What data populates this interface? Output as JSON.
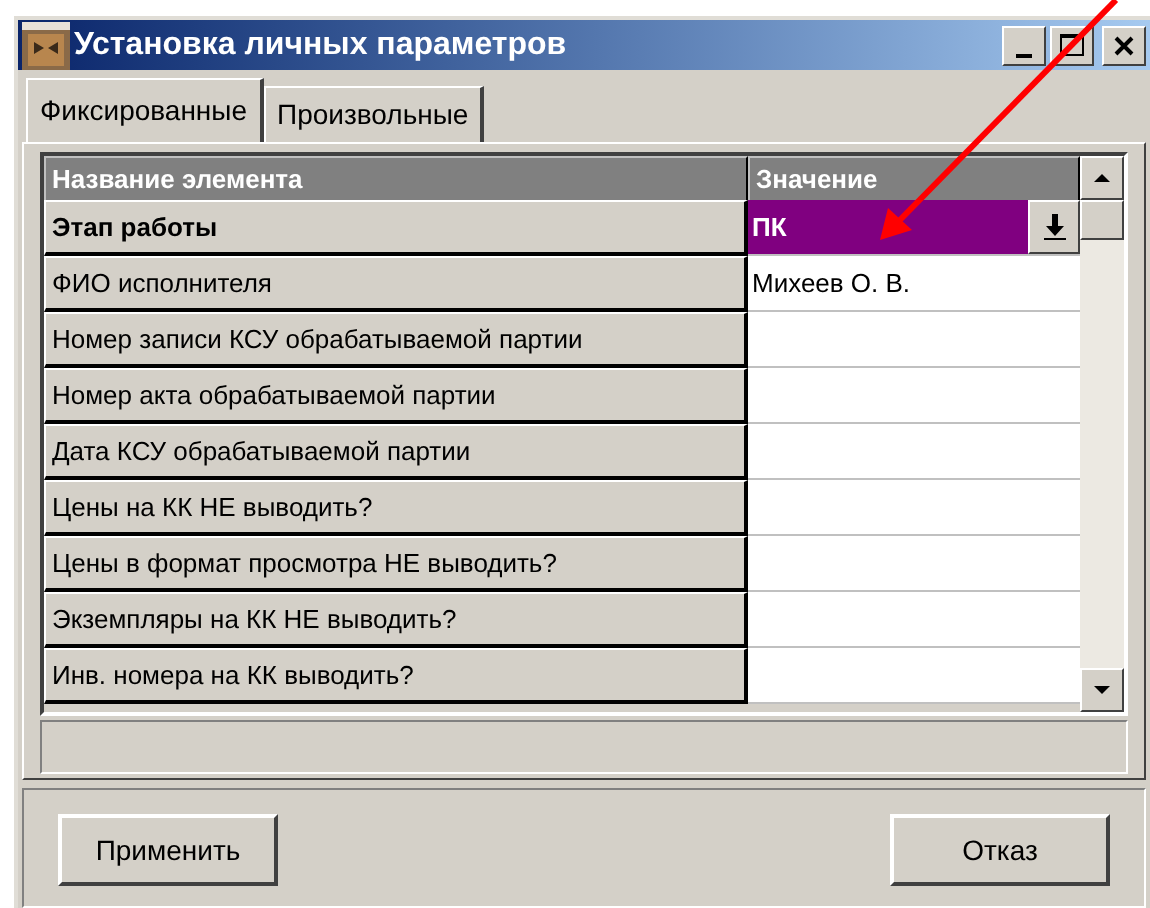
{
  "window": {
    "title": "Установка личных параметров"
  },
  "tabs": [
    {
      "label": "Фиксированные",
      "selected": true
    },
    {
      "label": "Произвольные",
      "selected": false
    }
  ],
  "table": {
    "columns": [
      "Название элемента",
      "Значение"
    ],
    "rows": [
      {
        "name": "Этап работы",
        "value": "ПК",
        "kind": "dropdown"
      },
      {
        "name": "ФИО исполнителя",
        "value": "Михеев О. В.",
        "kind": "text"
      },
      {
        "name": "Номер записи КСУ обрабатываемой партии",
        "kind": "text"
      },
      {
        "name": "Номер акта обрабатываемой партии",
        "kind": "text"
      },
      {
        "name": "Дата КСУ обрабатываемой партии",
        "kind": "text"
      },
      {
        "name": "Цены на КК НЕ выводить?",
        "kind": "text"
      },
      {
        "name": "Цены в формат просмотра НЕ выводить?",
        "kind": "text"
      },
      {
        "name": "Экземпляры на КК НЕ выводить?",
        "kind": "text"
      },
      {
        "name": "Инв. номера на КК выводить?",
        "kind": "text"
      }
    ]
  },
  "buttons": [
    "Применить",
    "Отказ"
  ]
}
